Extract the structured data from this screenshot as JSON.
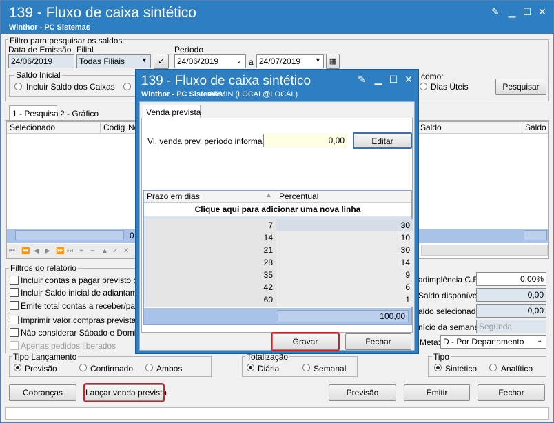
{
  "main": {
    "title": "139 - Fluxo de caixa sintético",
    "subtitle": "Winthor - PC Sistemas",
    "filter_group": "Filtro para pesquisar os saldos",
    "emission_label": "Data de Emissão",
    "emission_value": "24/06/2019",
    "branch_label": "Filial",
    "branch_value": "Todas Filiais",
    "period_label": "Período",
    "period_from": "24/06/2019",
    "period_to_label": "a",
    "period_to": "24/07/2019",
    "initial_balance_group": "Saldo Inicial",
    "initial_balance_option": "Incluir Saldo dos Caixas",
    "como_label": "como:",
    "dias_uteis": "Dias Úteis",
    "search_button": "Pesquisar",
    "tabs": [
      "1 - Pesquisa",
      "2 - Gráfico"
    ],
    "grid_headers": [
      "Selecionado",
      "Código",
      "No",
      "Saldo",
      "Saldo se"
    ],
    "row_count_fragment": "0",
    "report_filters_group": "Filtros do relatório",
    "report_filters": [
      "Incluir contas a pagar previsto com",
      "Incluir Saldo inicial de adiantamento",
      "Emite total contas a receber/pagar",
      "Imprimir valor compras prevista ant",
      "Não considerar Sábado e Domingo",
      "Apenas pedidos liberados"
    ],
    "right_labels": [
      "adimplência C.R.",
      "Saldo disponível:",
      "aldo selecionado:",
      "nício da semana:",
      "Meta:"
    ],
    "right_values": [
      "0,00%",
      "0,00",
      "0,00",
      "Segunda",
      "D - Por Departamento"
    ],
    "launch_type_group": "Tipo Lançamento",
    "launch_type_options": [
      "Provisão",
      "Confirmado",
      "Ambos"
    ],
    "totalization_group": "Totalização",
    "totalization_options": [
      "Diária",
      "Semanal"
    ],
    "type_group": "Tipo",
    "type_options": [
      "Sintético",
      "Analítico"
    ],
    "buttons": {
      "cobrancas": "Cobranças",
      "lancar": "Lançar venda prevista",
      "previsao": "Previsão",
      "emitir": "Emitir",
      "fechar": "Fechar"
    }
  },
  "dialog": {
    "title": "139 - Fluxo de caixa sintético",
    "subtitle": "Winthor - PC Sistemas",
    "user": "ADMIN (LOCAL@LOCAL)",
    "tab": "Venda prevista",
    "field_label": "Vl. venda prev. período informado:",
    "field_value": "0,00",
    "edit_button": "Editar",
    "grid_headers": [
      "Prazo em dias",
      "Percentual"
    ],
    "add_row": "Clique aqui para adicionar uma nova linha",
    "rows": [
      {
        "days": "7",
        "pct": "30"
      },
      {
        "days": "14",
        "pct": "10"
      },
      {
        "days": "21",
        "pct": "30"
      },
      {
        "days": "28",
        "pct": "14"
      },
      {
        "days": "35",
        "pct": "9"
      },
      {
        "days": "42",
        "pct": "6"
      },
      {
        "days": "60",
        "pct": "1"
      }
    ],
    "total": "100,00",
    "save_button": "Gravar",
    "close_button": "Fechar"
  },
  "colors": {
    "titlebar": "#2d7fc1",
    "highlight": "#d0202a",
    "grid_blue": "#a9c2e8"
  }
}
